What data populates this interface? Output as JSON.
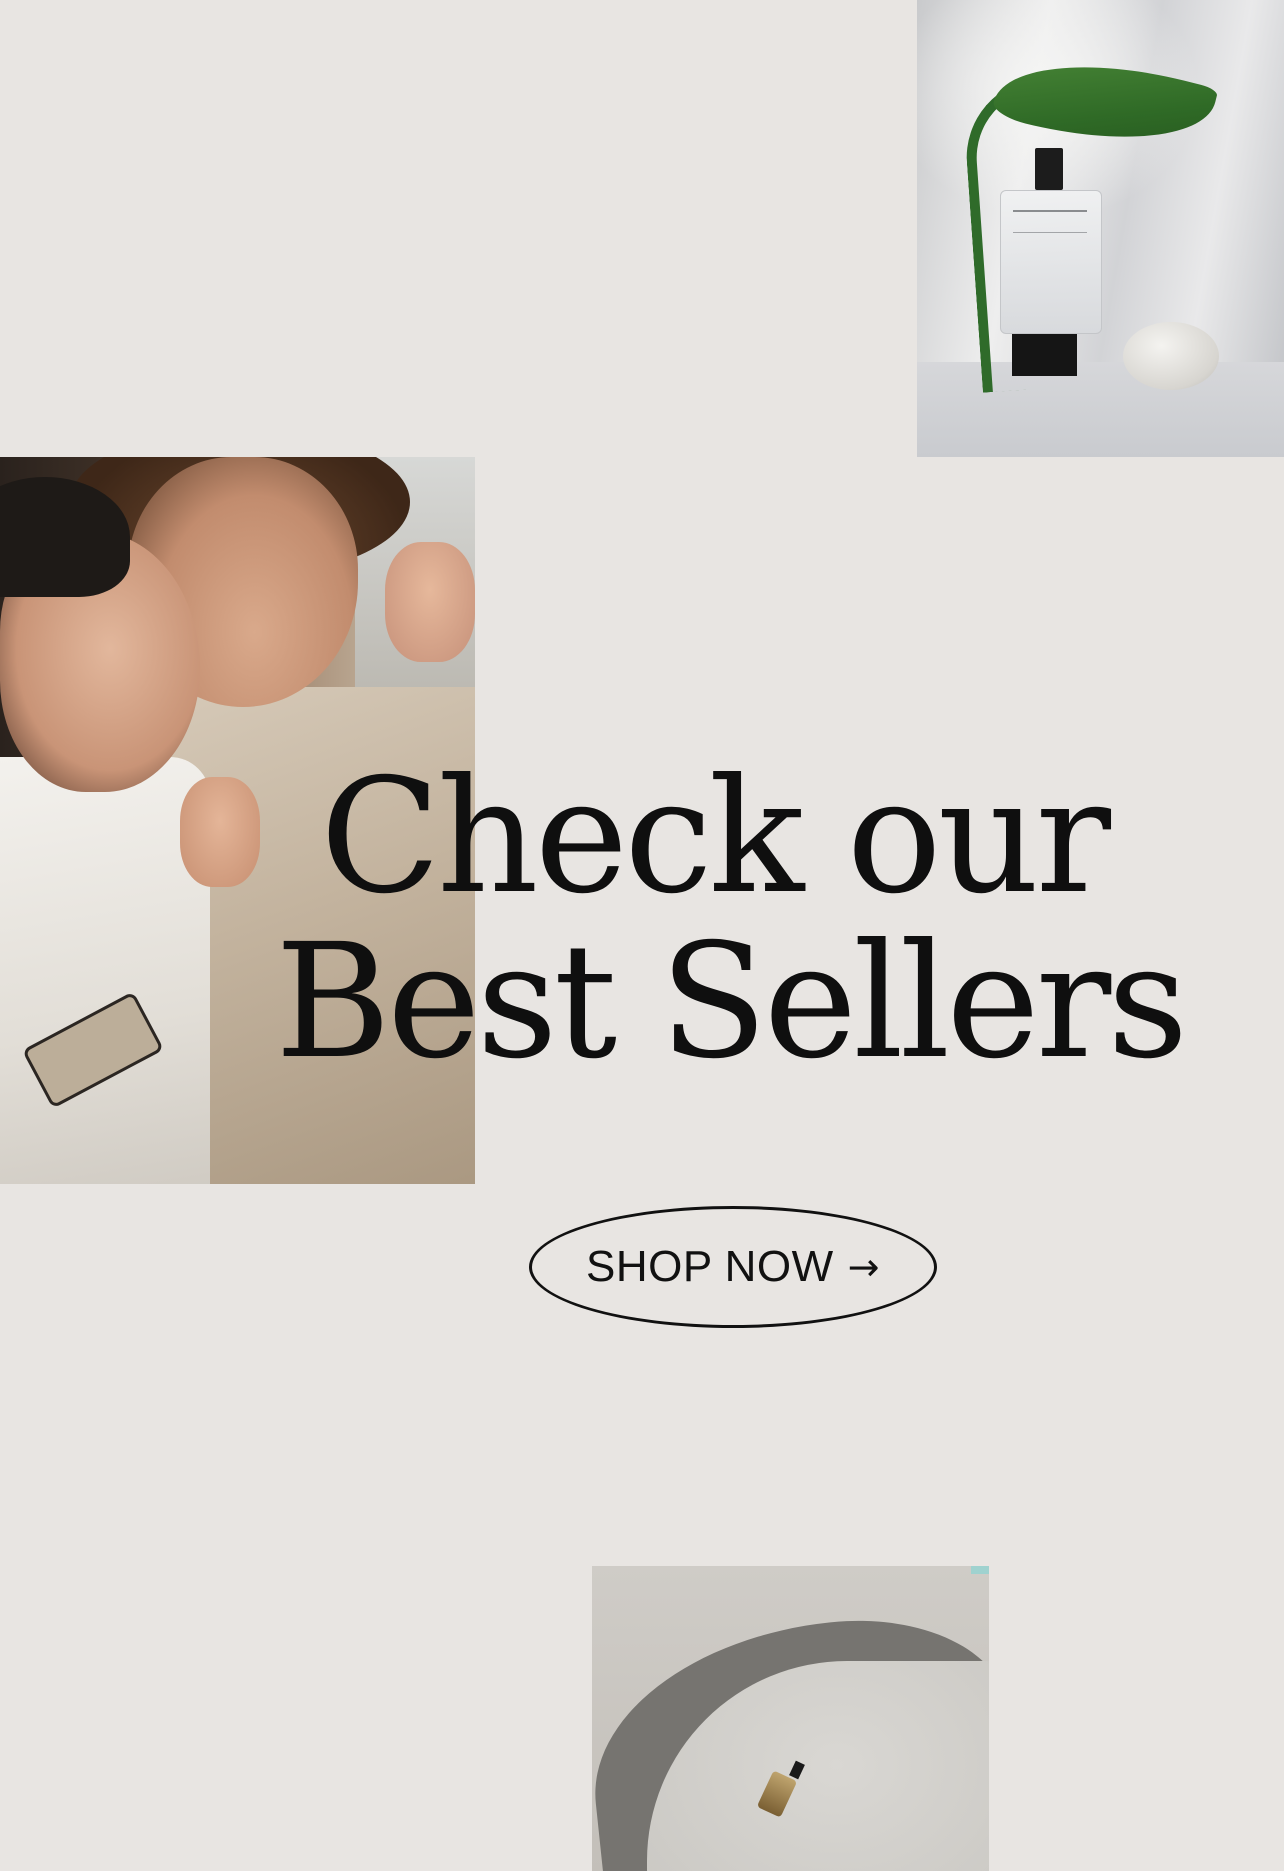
{
  "images": {
    "perfume": "perfume bottle with leaf and stone",
    "couple": "couple embracing",
    "bench": "small bottle on stone bench"
  },
  "headline": {
    "line1": "Check our",
    "line2": "Best Sellers"
  },
  "cta": {
    "label": "SHOP NOW",
    "icon": "arrow-right-icon",
    "arrow_glyph": "→"
  },
  "colors": {
    "background": "#e8e5e2",
    "text": "#0f0f0f"
  }
}
